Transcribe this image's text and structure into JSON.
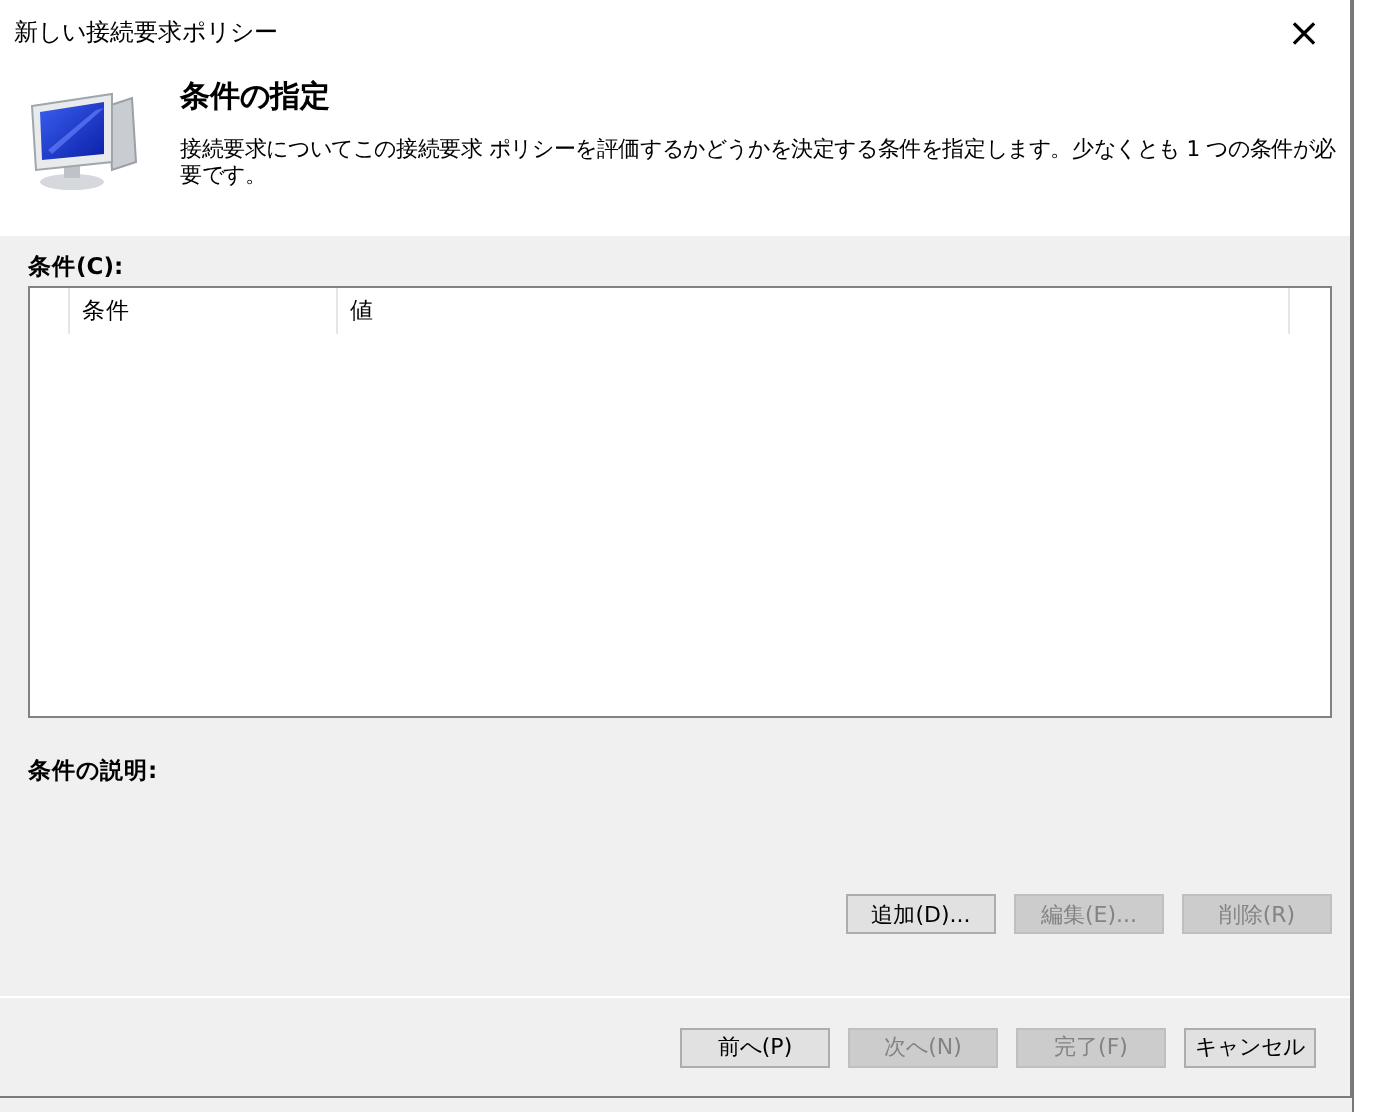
{
  "window": {
    "title": "新しい接続要求ポリシー",
    "close": "×"
  },
  "header": {
    "title": "条件の指定",
    "description": "接続要求についてこの接続要求 ポリシーを評価するかどうかを決定する条件を指定します。少なくとも 1 つの条件が必要です。"
  },
  "conditions": {
    "label": "条件(C):",
    "columns": [
      "条件",
      "値"
    ]
  },
  "description_label": "条件の説明:",
  "actions": [
    {
      "label": "追加(D)...",
      "disabled": false
    },
    {
      "label": "編集(E)...",
      "disabled": true
    },
    {
      "label": "削除(R)",
      "disabled": true
    }
  ],
  "nav_buttons": [
    {
      "label": "前へ(P)",
      "disabled": false
    },
    {
      "label": "次へ(N)",
      "disabled": true
    },
    {
      "label": "完了(F)",
      "disabled": true
    },
    {
      "label": "キャンセル",
      "disabled": false
    }
  ]
}
